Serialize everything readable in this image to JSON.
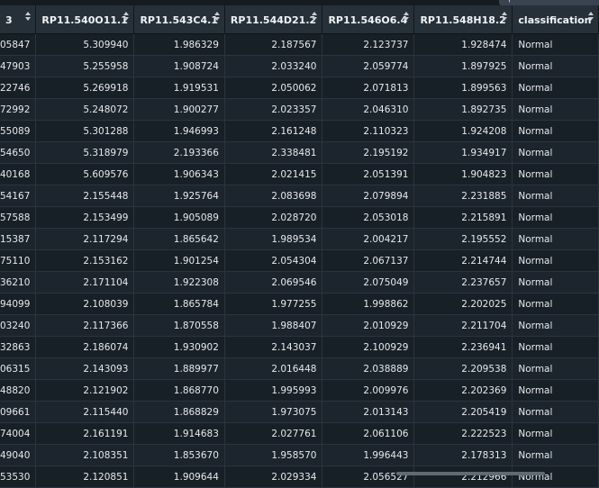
{
  "table": {
    "columns": [
      {
        "label": "3"
      },
      {
        "label": "RP11.540O11.1"
      },
      {
        "label": "RP11.543C4.1"
      },
      {
        "label": "RP11.544D21.2"
      },
      {
        "label": "RP11.546O6.4"
      },
      {
        "label": "RP11.548H18.2"
      },
      {
        "label": "classification"
      }
    ],
    "rows": [
      {
        "cells": [
          "05847",
          "5.309940",
          "1.986329",
          "2.187567",
          "2.123737",
          "1.928474",
          "Normal"
        ]
      },
      {
        "cells": [
          "47903",
          "5.255958",
          "1.908724",
          "2.033240",
          "2.059774",
          "1.897925",
          "Normal"
        ]
      },
      {
        "cells": [
          "22746",
          "5.269918",
          "1.919531",
          "2.050062",
          "2.071813",
          "1.899563",
          "Normal"
        ]
      },
      {
        "cells": [
          "72992",
          "5.248072",
          "1.900277",
          "2.023357",
          "2.046310",
          "1.892735",
          "Normal"
        ]
      },
      {
        "cells": [
          "55089",
          "5.301288",
          "1.946993",
          "2.161248",
          "2.110323",
          "1.924208",
          "Normal"
        ]
      },
      {
        "cells": [
          "54650",
          "5.318979",
          "2.193366",
          "2.338481",
          "2.195192",
          "1.934917",
          "Normal"
        ]
      },
      {
        "cells": [
          "40168",
          "5.609576",
          "1.906343",
          "2.021415",
          "2.051391",
          "1.904823",
          "Normal"
        ]
      },
      {
        "cells": [
          "54167",
          "2.155448",
          "1.925764",
          "2.083698",
          "2.079894",
          "2.231885",
          "Normal"
        ]
      },
      {
        "cells": [
          "57588",
          "2.153499",
          "1.905089",
          "2.028720",
          "2.053018",
          "2.215891",
          "Normal"
        ]
      },
      {
        "cells": [
          "15387",
          "2.117294",
          "1.865642",
          "1.989534",
          "2.004217",
          "2.195552",
          "Normal"
        ]
      },
      {
        "cells": [
          "75110",
          "2.153162",
          "1.901254",
          "2.054304",
          "2.067137",
          "2.214744",
          "Normal"
        ]
      },
      {
        "cells": [
          "36210",
          "2.171104",
          "1.922308",
          "2.069546",
          "2.075049",
          "2.237657",
          "Normal"
        ]
      },
      {
        "cells": [
          "94099",
          "2.108039",
          "1.865784",
          "1.977255",
          "1.998862",
          "2.202025",
          "Normal"
        ]
      },
      {
        "cells": [
          "03240",
          "2.117366",
          "1.870558",
          "1.988407",
          "2.010929",
          "2.211704",
          "Normal"
        ]
      },
      {
        "cells": [
          "32863",
          "2.186074",
          "1.930902",
          "2.143037",
          "2.100929",
          "2.236941",
          "Normal"
        ]
      },
      {
        "cells": [
          "06315",
          "2.143093",
          "1.889977",
          "2.016448",
          "2.038889",
          "2.209538",
          "Normal"
        ]
      },
      {
        "cells": [
          "48820",
          "2.121902",
          "1.868770",
          "1.995993",
          "2.009976",
          "2.202369",
          "Normal"
        ]
      },
      {
        "cells": [
          "09661",
          "2.115440",
          "1.868829",
          "1.973075",
          "2.013143",
          "2.205419",
          "Normal"
        ]
      },
      {
        "cells": [
          "74004",
          "2.161191",
          "1.914683",
          "2.027761",
          "2.061106",
          "2.222523",
          "Normal"
        ]
      },
      {
        "cells": [
          "49040",
          "2.108351",
          "1.853670",
          "1.958570",
          "1.996443",
          "2.178313",
          "Normal"
        ]
      },
      {
        "cells": [
          "53530",
          "2.120851",
          "1.909644",
          "2.029334",
          "2.056527",
          "2.212966",
          "Normal"
        ]
      }
    ]
  }
}
